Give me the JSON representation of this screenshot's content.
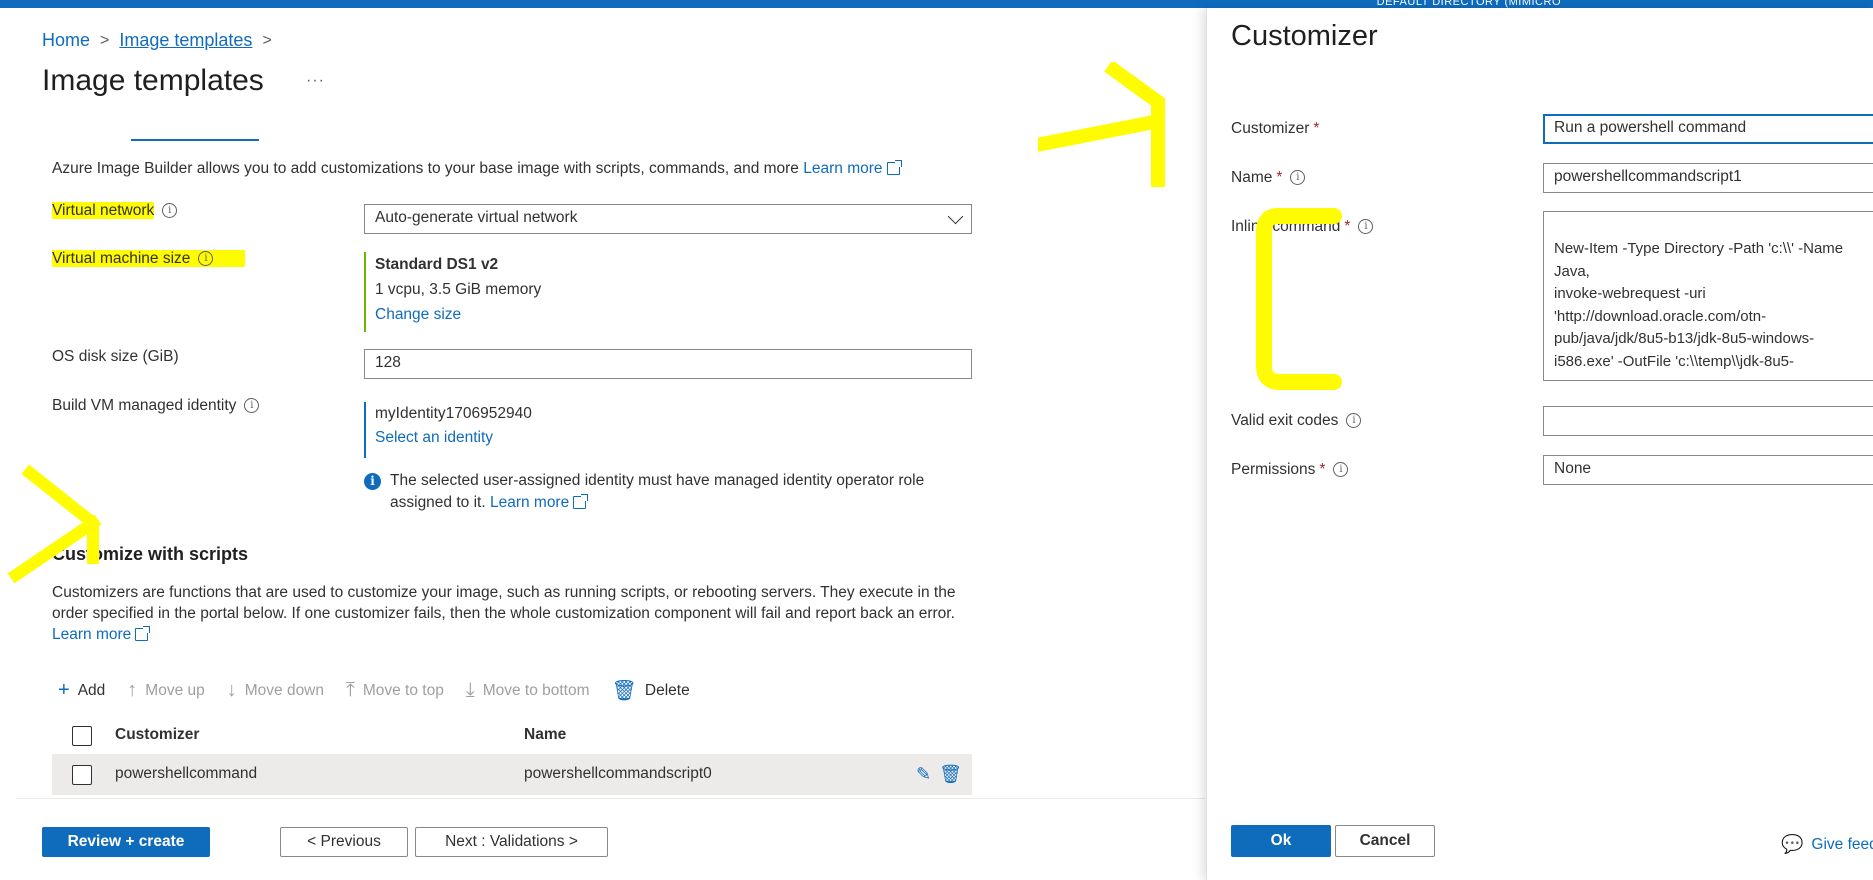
{
  "topbar": {
    "directory_text": "DEFAULT DIRECTORY (MIMICRO"
  },
  "breadcrumb": {
    "home": "Home",
    "current": "Image templates",
    "sep": ">"
  },
  "page": {
    "title": "Image templates",
    "more": "···"
  },
  "intro": {
    "text": "Azure Image Builder allows you to add customizations to your base image with scripts, commands, and more ",
    "learn_more": "Learn more"
  },
  "fields": {
    "virtual_network": {
      "label": "Virtual network",
      "value": "Auto-generate virtual network"
    },
    "vm_size": {
      "label": "Virtual machine size",
      "name": "Standard DS1 v2",
      "spec": "1 vcpu, 3.5 GiB memory",
      "change": "Change size"
    },
    "os_disk": {
      "label": "OS disk size (GiB)",
      "value": "128"
    },
    "build_identity": {
      "label": "Build VM managed identity",
      "value": "myIdentity1706952940",
      "select": "Select an identity",
      "note": "The selected user-assigned identity must have managed identity operator role assigned to it. ",
      "learn_more": "Learn more"
    }
  },
  "scripts": {
    "title": "Customize with scripts",
    "desc": "Customizers are functions that are used to customize your image, such as running scripts, or rebooting servers. They execute in the order specified in the portal below. If one customizer fails, then the whole customization component will fail and report back an error. ",
    "learn_more": "Learn more",
    "toolbar": {
      "add": "Add",
      "move_up": "Move up",
      "move_down": "Move down",
      "move_top": "Move to top",
      "move_bottom": "Move to bottom",
      "delete": "Delete"
    },
    "columns": {
      "customizer": "Customizer",
      "name": "Name"
    },
    "rows": [
      {
        "customizer": "powershellcommand",
        "name": "powershellcommandscript0"
      }
    ]
  },
  "footer": {
    "review": "Review + create",
    "previous": "< Previous",
    "next": "Next : Validations >"
  },
  "panel": {
    "title": "Customizer",
    "customizer": {
      "label": "Customizer",
      "value": "Run a powershell command"
    },
    "name": {
      "label": "Name",
      "value": "powershellcommandscript1"
    },
    "inline": {
      "label": "Inline command",
      "lines": [
        "New-Item -Type Directory -Path 'c:\\\\' -Name",
        "Java,",
        "invoke-webrequest -uri",
        "'http://download.oracle.com/otn-",
        "pub/java/jdk/8u5-b13/jdk-8u5-windows-",
        "i586.exe'  -OutFile 'c:\\\\temp\\\\jdk-8u5-"
      ]
    },
    "exit_codes": {
      "label": "Valid exit codes",
      "value": ""
    },
    "permissions": {
      "label": "Permissions",
      "value": "None"
    },
    "ok": "Ok",
    "cancel": "Cancel",
    "feedback": "Give feedback"
  },
  "colors": {
    "accent": "#0f6cbd",
    "highlight": "#fffb00",
    "required": "#a4262c"
  }
}
